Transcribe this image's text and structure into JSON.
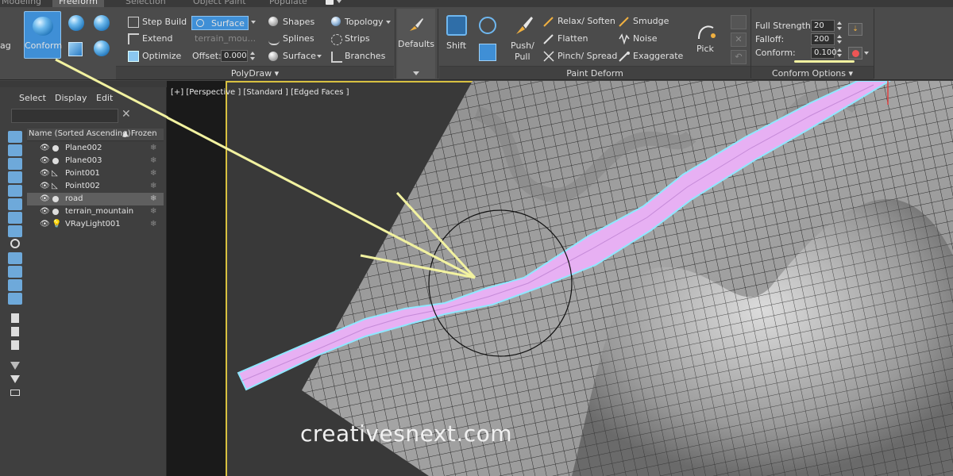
{
  "tabs": [
    "Modeling",
    "Freeform",
    "Selection",
    "Object Paint",
    "Populate"
  ],
  "ribbon": {
    "left_cut_label": "ag",
    "conform_label": "Conform",
    "polydraw": {
      "step_build": "Step Build",
      "extend": "Extend",
      "optimize": "Optimize",
      "surface_btn": "Surface",
      "surface_object": "terrain_mou...",
      "offset_label": "Offset:",
      "offset_value": "0.000",
      "shapes": "Shapes",
      "splines": "Splines",
      "surface": "Surface",
      "topology": "Topology",
      "strips": "Strips",
      "branches": "Branches",
      "footer": "PolyDraw"
    },
    "defaults_label": "Defaults",
    "paint_deform": {
      "shift": "Shift",
      "push_pull_line1": "Push/",
      "push_pull_line2": "Pull",
      "relax_soften": "Relax/ Soften",
      "flatten": "Flatten",
      "pinch_spread": "Pinch/ Spread",
      "smudge": "Smudge",
      "noise": "Noise",
      "exaggerate": "Exaggerate",
      "pick": "Pick",
      "footer": "Paint Deform"
    },
    "conform_options": {
      "full_strength_label": "Full Strength:",
      "full_strength_value": "20",
      "falloff_label": "Falloff:",
      "falloff_value": "200",
      "conform_label": "Conform:",
      "conform_value": "0.100",
      "footer": "Conform Options"
    }
  },
  "explorer": {
    "menu": [
      "Select",
      "Display",
      "Edit"
    ],
    "col_name": "Name (Sorted Ascending)",
    "col_frozen": "Frozen",
    "rows": [
      {
        "name": "Plane002",
        "type": "sphere"
      },
      {
        "name": "Plane003",
        "type": "sphere"
      },
      {
        "name": "Point001",
        "type": "helper"
      },
      {
        "name": "Point002",
        "type": "helper"
      },
      {
        "name": "road",
        "type": "sphere"
      },
      {
        "name": "terrain_mountain",
        "type": "sphere"
      },
      {
        "name": "VRayLight001",
        "type": "light"
      }
    ],
    "selected_row": "road"
  },
  "viewport": {
    "label": "[+] [Perspective ] [Standard ] [Edged Faces ]",
    "watermark": "creativesnext.com"
  },
  "colors": {
    "accent_blue": "#3f8fd6",
    "road_fill": "#e7b0f3",
    "road_edge": "#8fe7ff",
    "annotation": "#f2f2a0"
  }
}
